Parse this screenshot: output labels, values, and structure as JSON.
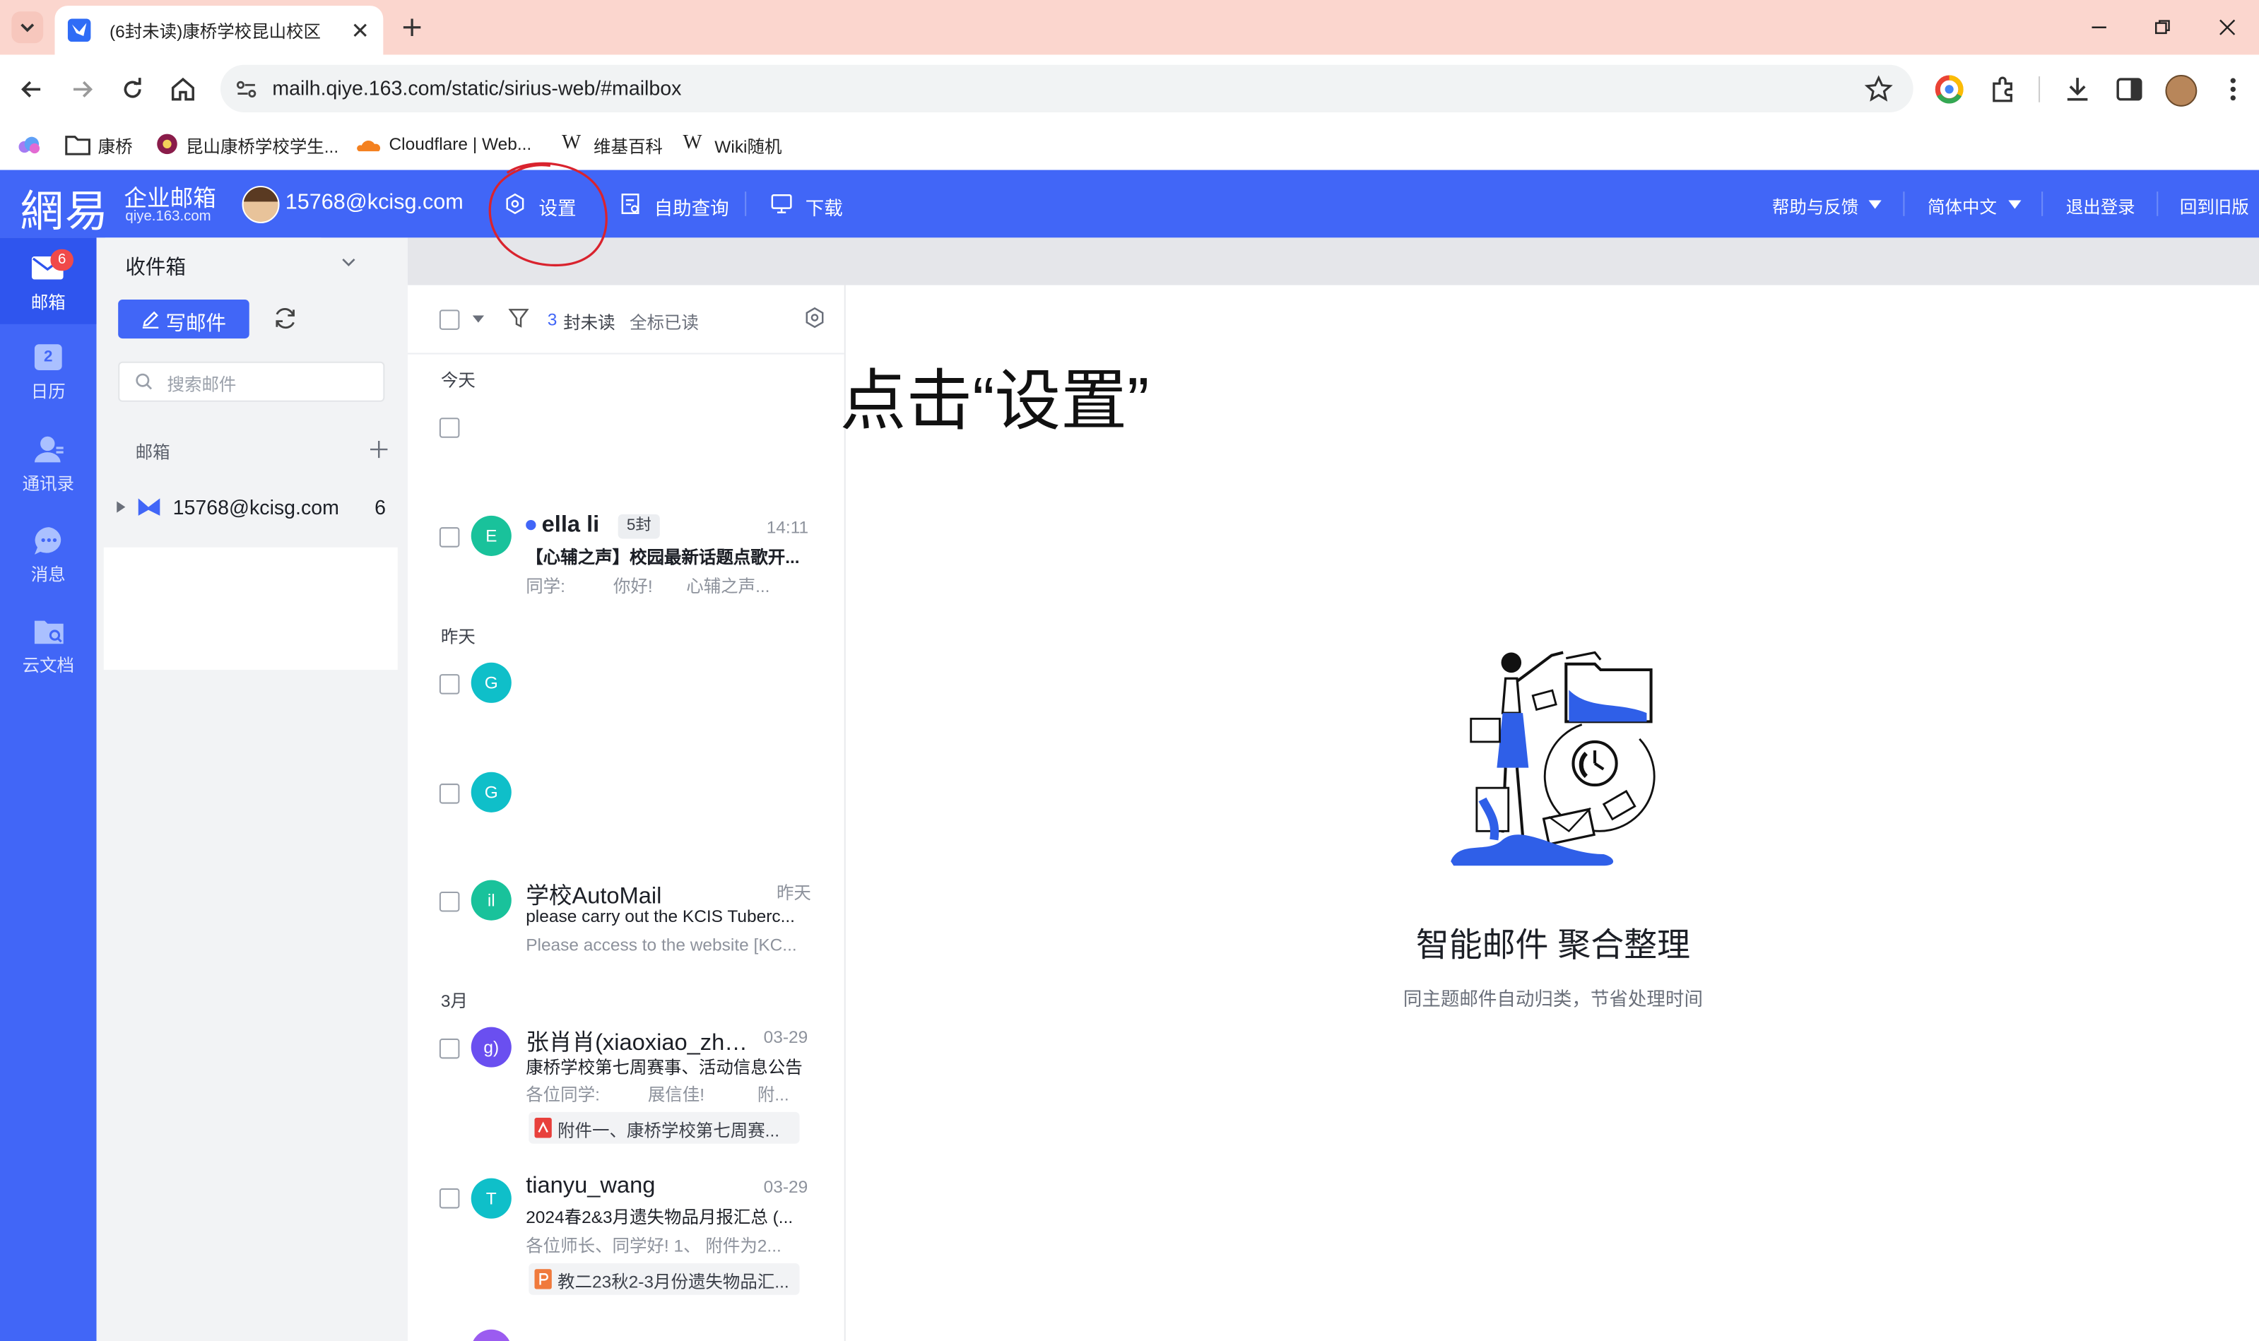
{
  "browser": {
    "tab_title": "(6封未读)康桥学校昆山校区",
    "url": "mailh.qiye.163.com/static/sirius-web/#mailbox",
    "bookmarks": [
      "康桥",
      "昆山康桥学校学生...",
      "Cloudflare | Web...",
      "维基百科",
      "Wiki随机"
    ]
  },
  "header": {
    "logo_main": "網易",
    "logo_product": "企业邮箱",
    "logo_domain": "qiye.163.com",
    "account": "15768@kcisg.com",
    "settings": "设置",
    "self_service": "自助查询",
    "download": "下载",
    "help": "帮助与反馈",
    "language": "简体中文",
    "logout": "退出登录",
    "old_version": "回到旧版"
  },
  "rail": {
    "mail": "邮箱",
    "mail_badge": "6",
    "calendar": "日历",
    "calendar_day": "2",
    "contacts": "通讯录",
    "messages": "消息",
    "docs": "云文档"
  },
  "folders": {
    "tab_label": "收件箱",
    "compose": "写邮件",
    "search_placeholder": "搜索邮件",
    "section": "邮箱",
    "account": "15768@kcisg.com",
    "account_count": "6"
  },
  "list": {
    "unread_count": "3",
    "unread_label": "封未读",
    "mark_all_read": "全标已读",
    "groups": {
      "today": "今天",
      "yesterday": "昨天",
      "march": "3月"
    },
    "emails": [
      {
        "avatar": "E",
        "avatar_color": "#19c29b",
        "sender": "ella li",
        "thread_count": "5封",
        "time": "14:11",
        "subject": "【心辅之声】校园最新话题点歌开...",
        "preview": "同学:          你好!       心辅之声..."
      },
      {
        "avatar": "G",
        "avatar_color": "#0fbfc9"
      },
      {
        "avatar": "G",
        "avatar_color": "#0fbfc9"
      },
      {
        "avatar": "il",
        "avatar_color": "#19c29b",
        "sender": "学校AutoMail",
        "time": "昨天",
        "subject": "please carry out the KCIS Tuberc...",
        "preview": "Please access to the website [KC..."
      },
      {
        "avatar": "g)",
        "avatar_color": "#6a4ff0",
        "sender": "张肖肖(xiaoxiao_zha...",
        "time": "03-29",
        "subject": "康桥学校第七周赛事、活动信息公告",
        "preview": "各位同学:          展信佳!           附...",
        "attachment": "附件一、康桥学校第七周赛..."
      },
      {
        "avatar": "T",
        "avatar_color": "#0fbfc9",
        "sender": "tianyu_wang",
        "time": "03-29",
        "subject": "2024春2&3月遗失物品月报汇总 (...",
        "preview": "各位师长、同学好! 1、 附件为2...",
        "attachment": "教二23秋2-3月份遗失物品汇..."
      }
    ]
  },
  "annotation": "点击“设置”",
  "empty_state": {
    "title": "智能邮件 聚合整理",
    "subtitle": "同主题邮件自动归类，节省处理时间"
  },
  "colors": {
    "brand": "#4166f7",
    "annotation_circle": "#d9232e",
    "tabbar": "#fbd6ce"
  }
}
